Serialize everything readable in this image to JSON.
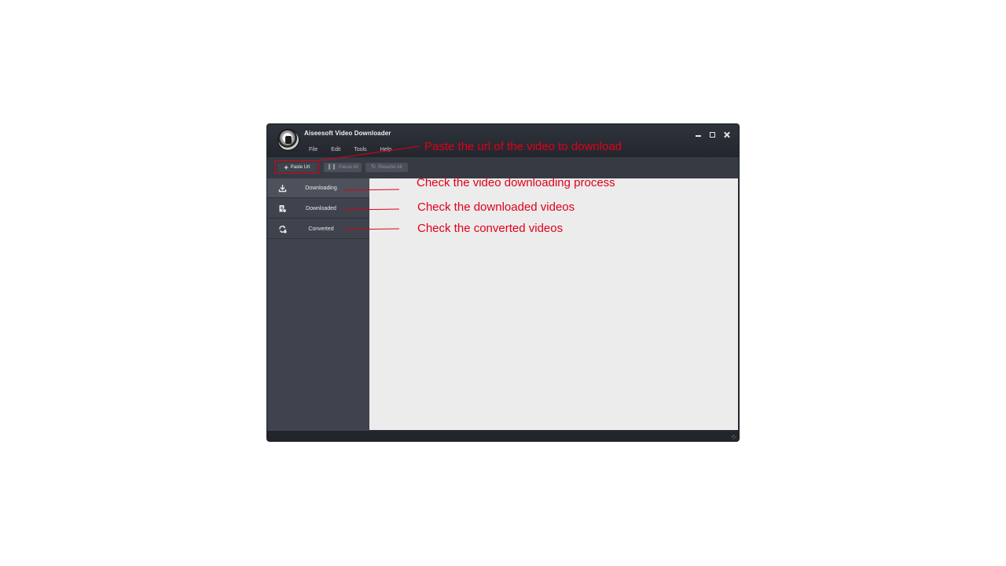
{
  "window": {
    "title": "Aiseesoft Video Downloader",
    "menu": [
      "File",
      "Edit",
      "Tools",
      "Help"
    ]
  },
  "toolbar": {
    "paste_label": "Paste Url",
    "pause_label": "Pause All",
    "resume_label": "Resume All"
  },
  "sidebar": {
    "items": [
      {
        "label": "Downloading",
        "icon": "download-icon",
        "active": true
      },
      {
        "label": "Downloaded",
        "icon": "downloaded-file-icon",
        "active": false
      },
      {
        "label": "Converted",
        "icon": "convert-icon",
        "active": false
      }
    ]
  },
  "annotations": {
    "paste": "Paste the url of the video to download",
    "downloading": "Check the video downloading process",
    "downloaded": "Check the downloaded videos",
    "converted": "Check the converted videos"
  },
  "colors": {
    "annotation": "#e0001a",
    "sidebar": "#3f434d",
    "content": "#ececec"
  }
}
